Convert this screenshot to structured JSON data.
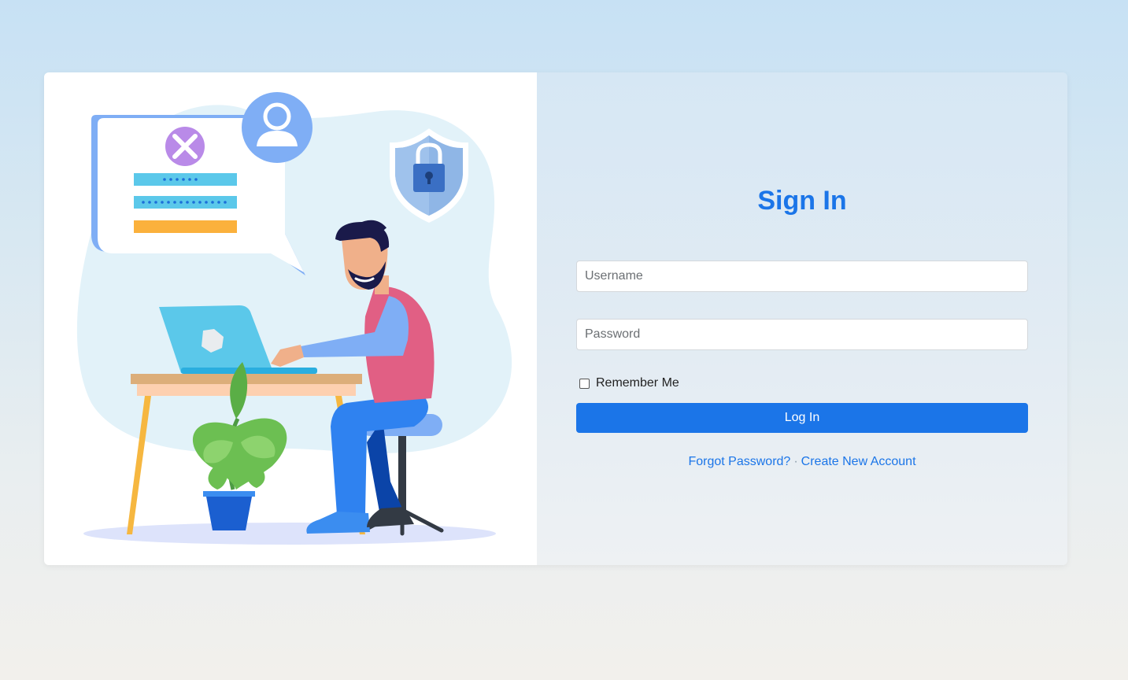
{
  "signin": {
    "title": "Sign In",
    "username_placeholder": "Username",
    "password_placeholder": "Password",
    "remember_label": "Remember Me",
    "login_label": "Log In",
    "forgot_label": "Forgot Password?",
    "separator": "·",
    "create_label": "Create New Account"
  },
  "colors": {
    "accent": "#1b75e8",
    "button_text": "#ffffff"
  },
  "illustration": {
    "icons": [
      "user-avatar-icon",
      "close-x-icon",
      "shield-lock-icon",
      "laptop-icon",
      "plant-icon"
    ]
  }
}
